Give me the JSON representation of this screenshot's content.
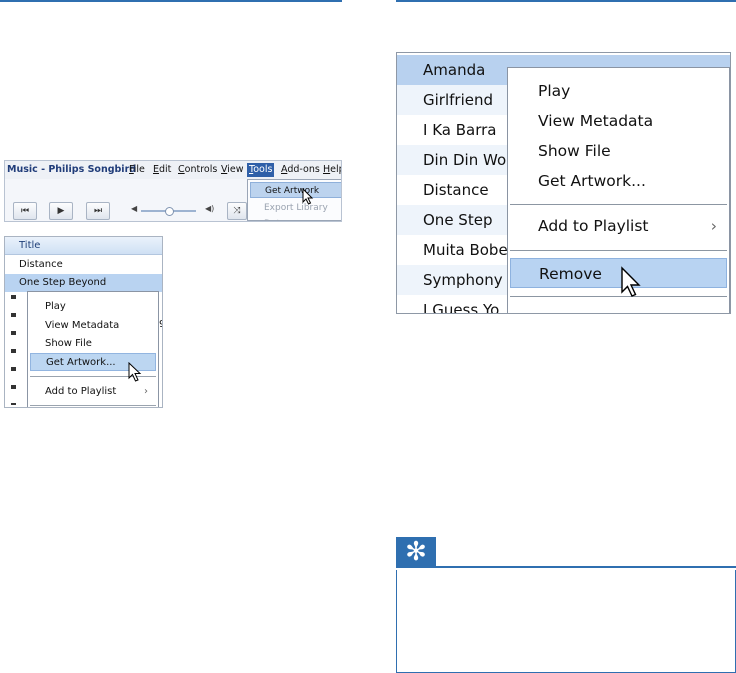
{
  "songbird": {
    "title": "Music - Philips Songbird",
    "menus": [
      {
        "label": "File",
        "u": "F",
        "rest": "ile"
      },
      {
        "label": "Edit",
        "u": "E",
        "rest": "dit"
      },
      {
        "label": "Controls",
        "u": "C",
        "rest": "ontrols"
      },
      {
        "label": "View",
        "u": "V",
        "rest": "iew"
      },
      {
        "label": "Tools",
        "u": "T",
        "rest": "ools"
      },
      {
        "label": "Add-ons",
        "u": "A",
        "rest": "dd-ons"
      },
      {
        "label": "Help",
        "u": "H",
        "rest": "elp"
      }
    ],
    "tools_menu": {
      "items": [
        "Get Artwork",
        "Export Library Data"
      ]
    },
    "controls": {
      "prev": "⏮",
      "play": "▶",
      "next": "⏭",
      "vol_low": "◀",
      "vol_high": "◀)",
      "shuffle": "⤨",
      "volume_level": 0.5
    }
  },
  "left_panel": {
    "header": "Title",
    "rows": [
      "Distance",
      "One Step Beyond"
    ],
    "context_menu": [
      "Play",
      "View Metadata",
      "Show File",
      "Get Artwork...",
      "Add to Playlist"
    ],
    "chevron": "›",
    "clipped_text": "9"
  },
  "right_panel": {
    "rows": [
      "Amanda",
      "Girlfriend",
      "I Ka Barra",
      "Din Din Wo",
      "Distance",
      "One Step",
      "Muita Bobe",
      "Symphony",
      "I Guess Yo"
    ],
    "context_menu": [
      "Play",
      "View Metadata",
      "Show File",
      "Get Artwork...",
      "Add to Playlist",
      "Remove"
    ],
    "chevron": "›"
  },
  "tip": {
    "icon": "✻"
  },
  "colors": {
    "accent": "#2f6fb0",
    "selection": "#b8d1ef",
    "menu_active": "#2e5fa8"
  }
}
